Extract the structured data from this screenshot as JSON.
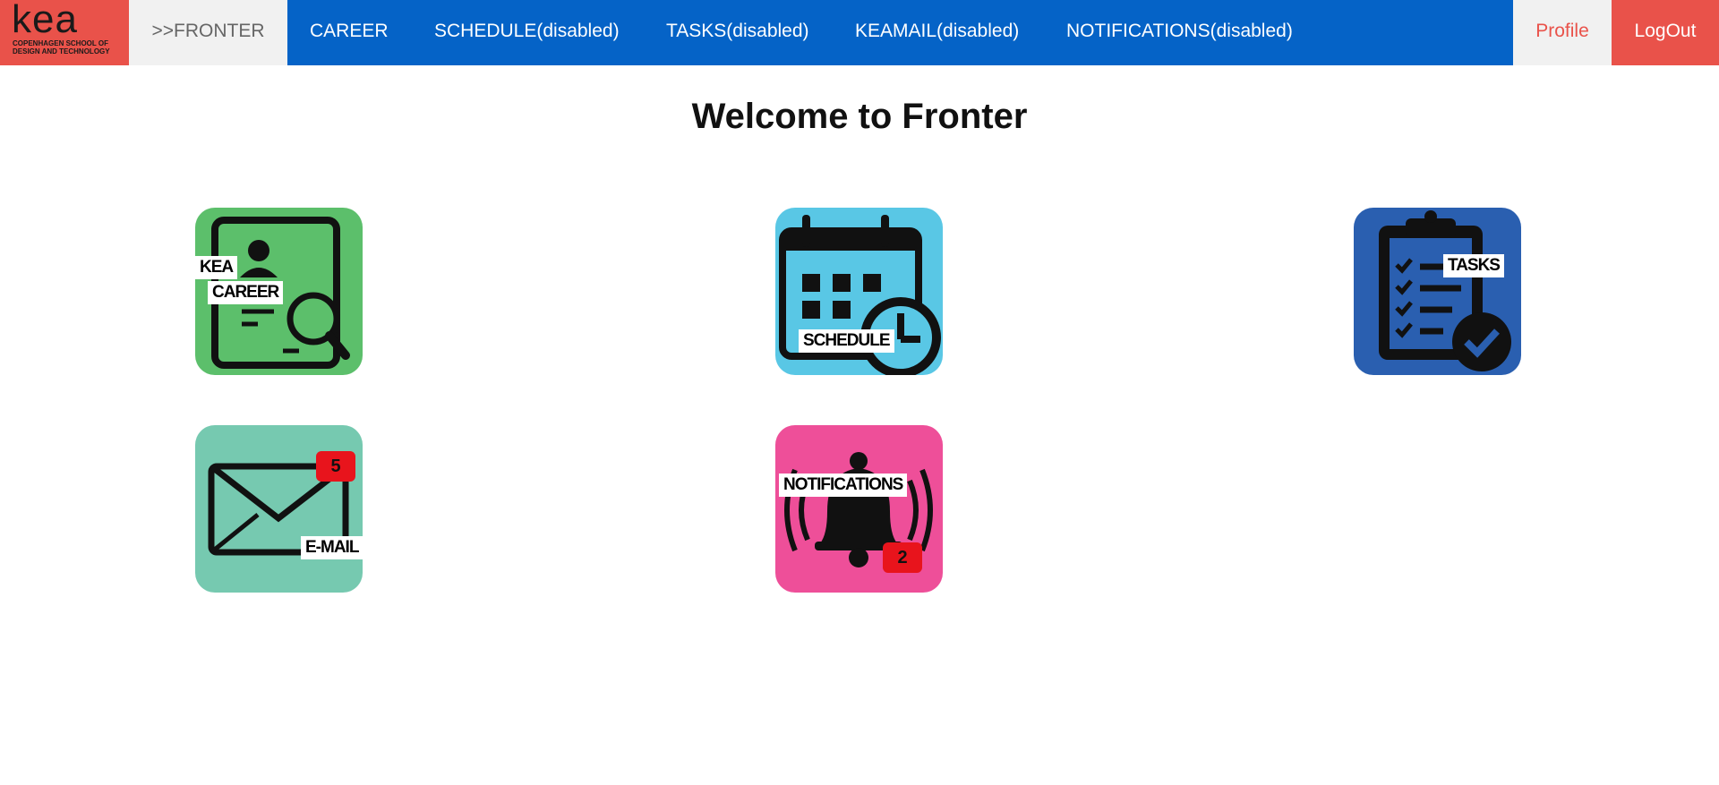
{
  "logo": {
    "word": "kea",
    "subtitle": "COPENHAGEN SCHOOL OF DESIGN AND TECHNOLOGY"
  },
  "nav": {
    "active": ">>FRONTER",
    "career": "CAREER",
    "schedule": "SCHEDULE(disabled)",
    "tasks": "TASKS(disabled)",
    "keamail": "KEAMAIL(disabled)",
    "notifications": "NOTIFICATIONS(disabled)",
    "profile": "Profile",
    "logout": "LogOut"
  },
  "page": {
    "title": "Welcome to Fronter"
  },
  "tiles": {
    "career": {
      "label_top": "KEA",
      "label_bottom": "CAREER",
      "icon": "career-search-icon",
      "color": "#5cbf6b"
    },
    "schedule": {
      "label": "SCHEDULE",
      "icon": "calendar-clock-icon",
      "color": "#59c7e5"
    },
    "tasks": {
      "label": "TASKS",
      "icon": "clipboard-check-icon",
      "color": "#2a5fb0"
    },
    "email": {
      "label": "E-MAIL",
      "icon": "envelope-icon",
      "badge": "5",
      "color": "#76c9b0"
    },
    "notifications": {
      "label": "NOTIFICATIONS",
      "icon": "bell-icon",
      "badge": "2",
      "color": "#ee4f99"
    }
  },
  "colors": {
    "nav_blue": "#0563c7",
    "brand_red": "#e9524a",
    "badge_red": "#e8141c"
  }
}
